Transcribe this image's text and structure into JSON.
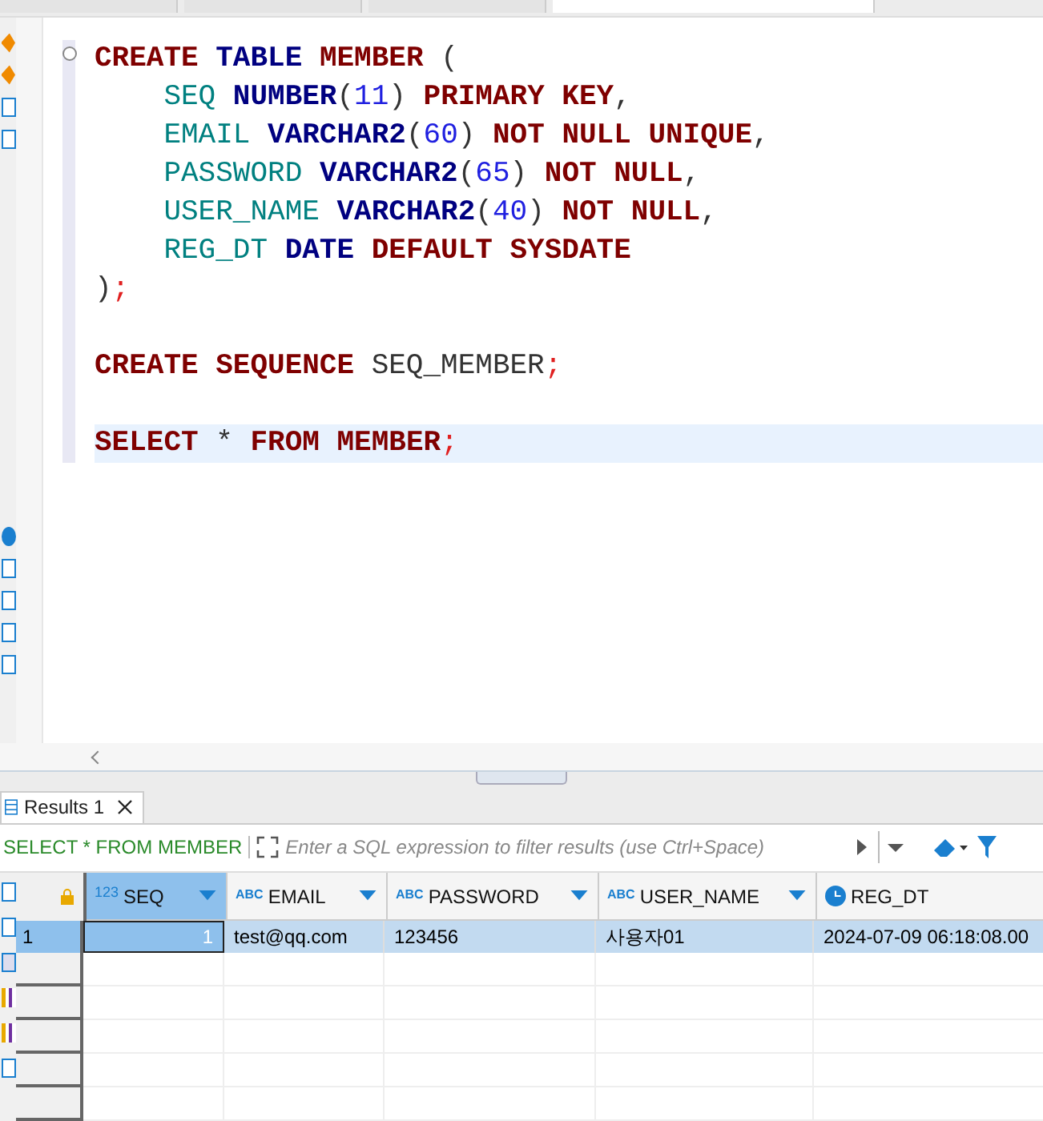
{
  "editor_tabs": [
    {
      "selected": false
    },
    {
      "selected": false
    },
    {
      "selected": false
    },
    {
      "selected": true
    }
  ],
  "editor": {
    "lines": [
      {
        "fold": true,
        "current": false,
        "tokens": [
          {
            "kind": "keyword",
            "text": "CREATE "
          },
          {
            "kind": "type",
            "text": "TABLE "
          },
          {
            "kind": "keyword",
            "text": "MEMBER "
          },
          {
            "kind": "plain",
            "text": "("
          }
        ]
      },
      {
        "fold": false,
        "current": false,
        "tokens": [
          {
            "kind": "column",
            "text": "    SEQ "
          },
          {
            "kind": "type",
            "text": "NUMBER"
          },
          {
            "kind": "plain",
            "text": "("
          },
          {
            "kind": "number",
            "text": "11"
          },
          {
            "kind": "plain",
            "text": ") "
          },
          {
            "kind": "keyword",
            "text": "PRIMARY KEY"
          },
          {
            "kind": "plain",
            "text": ","
          }
        ]
      },
      {
        "fold": false,
        "current": false,
        "tokens": [
          {
            "kind": "column",
            "text": "    EMAIL "
          },
          {
            "kind": "type",
            "text": "VARCHAR2"
          },
          {
            "kind": "plain",
            "text": "("
          },
          {
            "kind": "number",
            "text": "60"
          },
          {
            "kind": "plain",
            "text": ") "
          },
          {
            "kind": "keyword",
            "text": "NOT NULL UNIQUE"
          },
          {
            "kind": "plain",
            "text": ","
          }
        ]
      },
      {
        "fold": false,
        "current": false,
        "tokens": [
          {
            "kind": "column",
            "text": "    PASSWORD "
          },
          {
            "kind": "type",
            "text": "VARCHAR2"
          },
          {
            "kind": "plain",
            "text": "("
          },
          {
            "kind": "number",
            "text": "65"
          },
          {
            "kind": "plain",
            "text": ") "
          },
          {
            "kind": "keyword",
            "text": "NOT NULL"
          },
          {
            "kind": "plain",
            "text": ","
          }
        ]
      },
      {
        "fold": false,
        "current": false,
        "tokens": [
          {
            "kind": "column",
            "text": "    USER_NAME "
          },
          {
            "kind": "type",
            "text": "VARCHAR2"
          },
          {
            "kind": "plain",
            "text": "("
          },
          {
            "kind": "number",
            "text": "40"
          },
          {
            "kind": "plain",
            "text": ") "
          },
          {
            "kind": "keyword",
            "text": "NOT NULL"
          },
          {
            "kind": "plain",
            "text": ","
          }
        ]
      },
      {
        "fold": false,
        "current": false,
        "tokens": [
          {
            "kind": "column",
            "text": "    REG_DT "
          },
          {
            "kind": "type",
            "text": "DATE "
          },
          {
            "kind": "keyword",
            "text": "DEFAULT SYSDATE"
          }
        ]
      },
      {
        "fold": false,
        "current": false,
        "tokens": [
          {
            "kind": "plain",
            "text": ")"
          },
          {
            "kind": "semicolon",
            "text": ";"
          }
        ]
      },
      {
        "fold": false,
        "current": false
      },
      {
        "fold": false,
        "current": false,
        "tokens": [
          {
            "kind": "keyword",
            "text": "CREATE SEQUENCE "
          },
          {
            "kind": "plain",
            "text": "SEQ_MEMBER"
          },
          {
            "kind": "semicolon",
            "text": ";"
          }
        ]
      },
      {
        "fold": false,
        "current": false
      },
      {
        "fold": false,
        "current": true,
        "tokens": [
          {
            "kind": "keyword",
            "text": "SELECT "
          },
          {
            "kind": "plain",
            "text": "* "
          },
          {
            "kind": "keyword",
            "text": "FROM MEMBER"
          },
          {
            "kind": "semicolon",
            "text": ";"
          }
        ]
      }
    ]
  },
  "results": {
    "tabs": [
      {
        "label": "Results 1",
        "selected": true
      }
    ],
    "query": "SELECT * FROM MEMBER",
    "filter": {
      "placeholder": "Enter a SQL expression to filter results (use Ctrl+Space)"
    },
    "columns": [
      {
        "type_label": "123",
        "name": "SEQ",
        "selected": true
      },
      {
        "type_label": "ABC",
        "name": "EMAIL",
        "selected": false
      },
      {
        "type_label": "ABC",
        "name": "PASSWORD",
        "selected": false
      },
      {
        "type_label": "ABC",
        "name": "USER_NAME",
        "selected": false
      },
      {
        "name": "REG_DT",
        "selected": false
      }
    ],
    "rows": [
      {
        "number": "1",
        "selected": true,
        "cells": [
          "1",
          "test@qq.com",
          "123456",
          "사용자01",
          "2024-07-09 06:18:08.00"
        ]
      }
    ]
  }
}
